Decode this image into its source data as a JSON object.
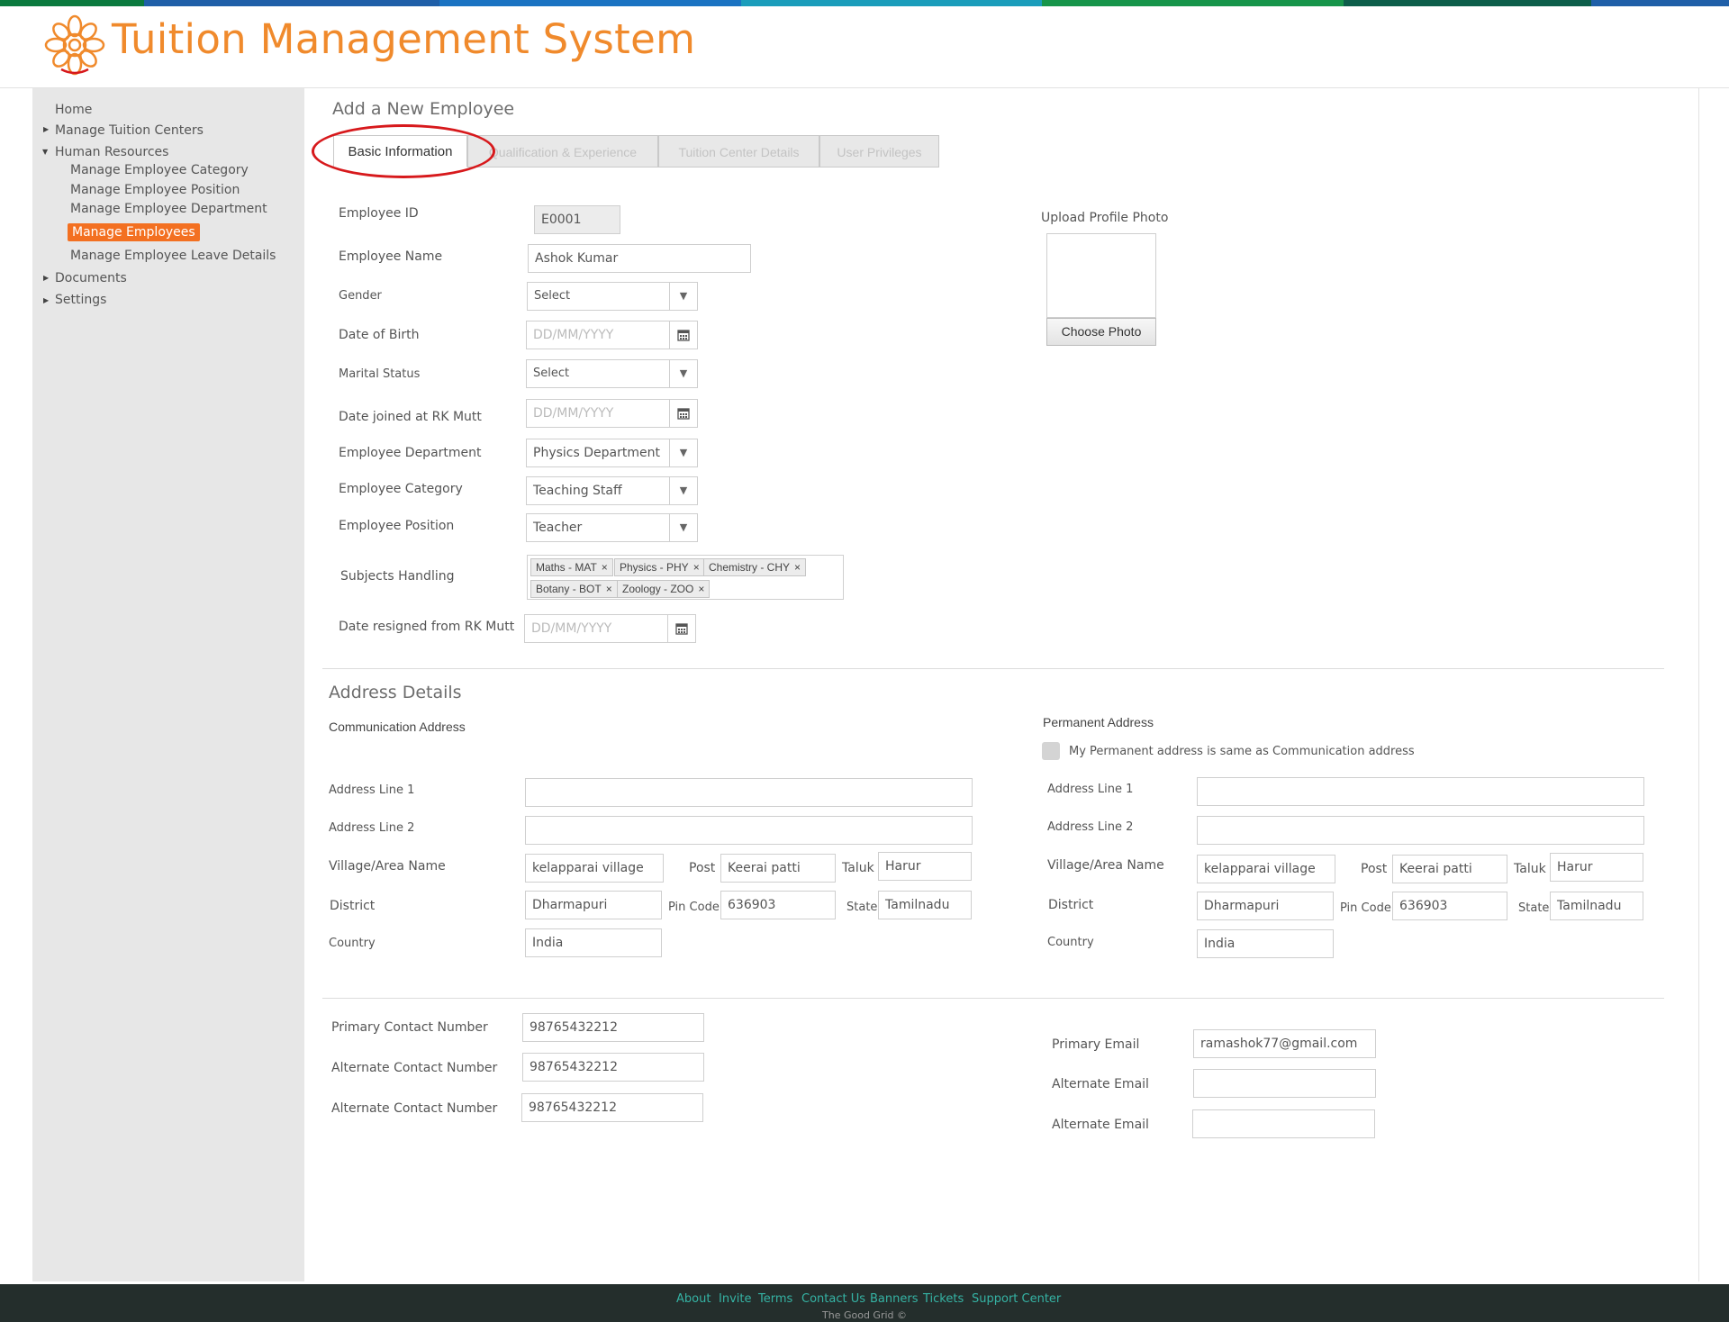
{
  "app": {
    "title": "Tuition Management System"
  },
  "colors": {
    "accent": "#f37021",
    "title": "#f08a2c",
    "footer_bg": "#242e2c",
    "footer_link": "#35b3a4",
    "highlight_circle": "#d7191c"
  },
  "sidebar": {
    "home": "Home",
    "manage_tuition_centers": "Manage Tuition Centers",
    "human_resources": "Human Resources",
    "manage_employee_category": "Manage Employee Category",
    "manage_employee_position": "Manage Employee Position",
    "manage_employee_department": "Manage Employee Department",
    "manage_employees": "Manage Employees",
    "manage_employee_leave_details": "Manage Employee Leave Details",
    "documents": "Documents",
    "settings": "Settings"
  },
  "page": {
    "title": "Add a New Employee"
  },
  "tabs": {
    "basic": "Basic Information",
    "qualification": "Qualification & Experience",
    "tuition_center": "Tuition Center Details",
    "privileges": "User Privileges"
  },
  "form": {
    "employee_id": {
      "label": "Employee ID",
      "value": "E0001"
    },
    "employee_name": {
      "label": "Employee Name",
      "value": "Ashok Kumar"
    },
    "gender": {
      "label": "Gender",
      "value": "Select"
    },
    "dob": {
      "label": "Date of Birth",
      "placeholder": "DD/MM/YYYY"
    },
    "marital": {
      "label": "Marital Status",
      "value": "Select"
    },
    "date_joined": {
      "label": "Date joined at RK Mutt",
      "placeholder": "DD/MM/YYYY"
    },
    "department": {
      "label": "Employee Department",
      "value": "Physics Department"
    },
    "category": {
      "label": "Employee Category",
      "value": "Teaching Staff"
    },
    "position": {
      "label": "Employee Position",
      "value": "Teacher"
    },
    "subjects": {
      "label": "Subjects Handling",
      "tags": [
        "Maths - MAT",
        "Physics - PHY",
        "Chemistry - CHY",
        "Botany - BOT",
        "Zoology - ZOO"
      ]
    },
    "date_resigned": {
      "label": "Date resigned from RK Mutt",
      "placeholder": "DD/MM/YYYY"
    }
  },
  "photo": {
    "label": "Upload Profile Photo",
    "button": "Choose Photo"
  },
  "address": {
    "title": "Address Details",
    "communication": {
      "heading": "Communication Address",
      "line1_label": "Address Line 1",
      "line1": "",
      "line2_label": "Address Line 2",
      "line2": "",
      "village_label": "Village/Area Name",
      "village": "kelapparai village",
      "post_label": "Post",
      "post": "Keerai patti",
      "taluk_label": "Taluk",
      "taluk": "Harur",
      "district_label": "District",
      "district": "Dharmapuri",
      "pin_label": "Pin Code",
      "pin": "636903",
      "state_label": "State",
      "state": "Tamilnadu",
      "country_label": "Country",
      "country": "India"
    },
    "permanent": {
      "heading": "Permanent Address",
      "same_label": "My Permanent address is same as Communication address",
      "line1_label": "Address Line 1",
      "line1": "",
      "line2_label": "Address Line 2",
      "line2": "",
      "village_label": "Village/Area Name",
      "village": "kelapparai village",
      "post_label": "Post",
      "post": "Keerai patti",
      "taluk_label": "Taluk",
      "taluk": "Harur",
      "district_label": "District",
      "district": "Dharmapuri",
      "pin_label": "Pin Code",
      "pin": "636903",
      "state_label": "State",
      "state": "Tamilnadu",
      "country_label": "Country",
      "country": "India"
    }
  },
  "contact": {
    "primary_number_label": "Primary Contact Number",
    "primary_number": "98765432212",
    "alt_number1_label": "Alternate Contact Number",
    "alt_number1": "98765432212",
    "alt_number2_label": "Alternate Contact Number",
    "alt_number2": "98765432212",
    "primary_email_label": "Primary Email",
    "primary_email": "ramashok77@gmail.com",
    "alt_email1_label": "Alternate Email",
    "alt_email1": "",
    "alt_email2_label": "Alternate Email",
    "alt_email2": ""
  },
  "footer": {
    "links": [
      "About",
      "Invite",
      "Terms",
      "Contact Us",
      "Banners",
      "Tickets",
      "Support Center"
    ],
    "copyright": "The Good Grid ©"
  }
}
